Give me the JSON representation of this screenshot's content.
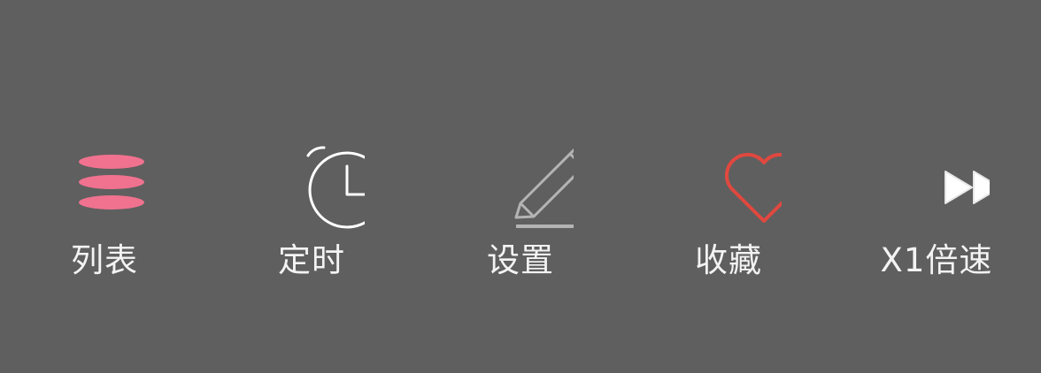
{
  "colors": {
    "background": "#5f5f5f",
    "label": "#f3f3f3",
    "list_icon": "#f0728f",
    "timer_icon": "#ffffff",
    "settings_icon": "#b4b4b4",
    "favorite_icon": "#e0483f",
    "speed_icon": "#ffffff"
  },
  "toolbar": {
    "items": [
      {
        "label": "列表",
        "icon": "list-icon"
      },
      {
        "label": "定时",
        "icon": "alarm-clock-icon"
      },
      {
        "label": "设置",
        "icon": "pencil-icon"
      },
      {
        "label": "收藏",
        "icon": "heart-icon"
      },
      {
        "label": "X1倍速",
        "icon": "fast-forward-icon"
      }
    ]
  }
}
